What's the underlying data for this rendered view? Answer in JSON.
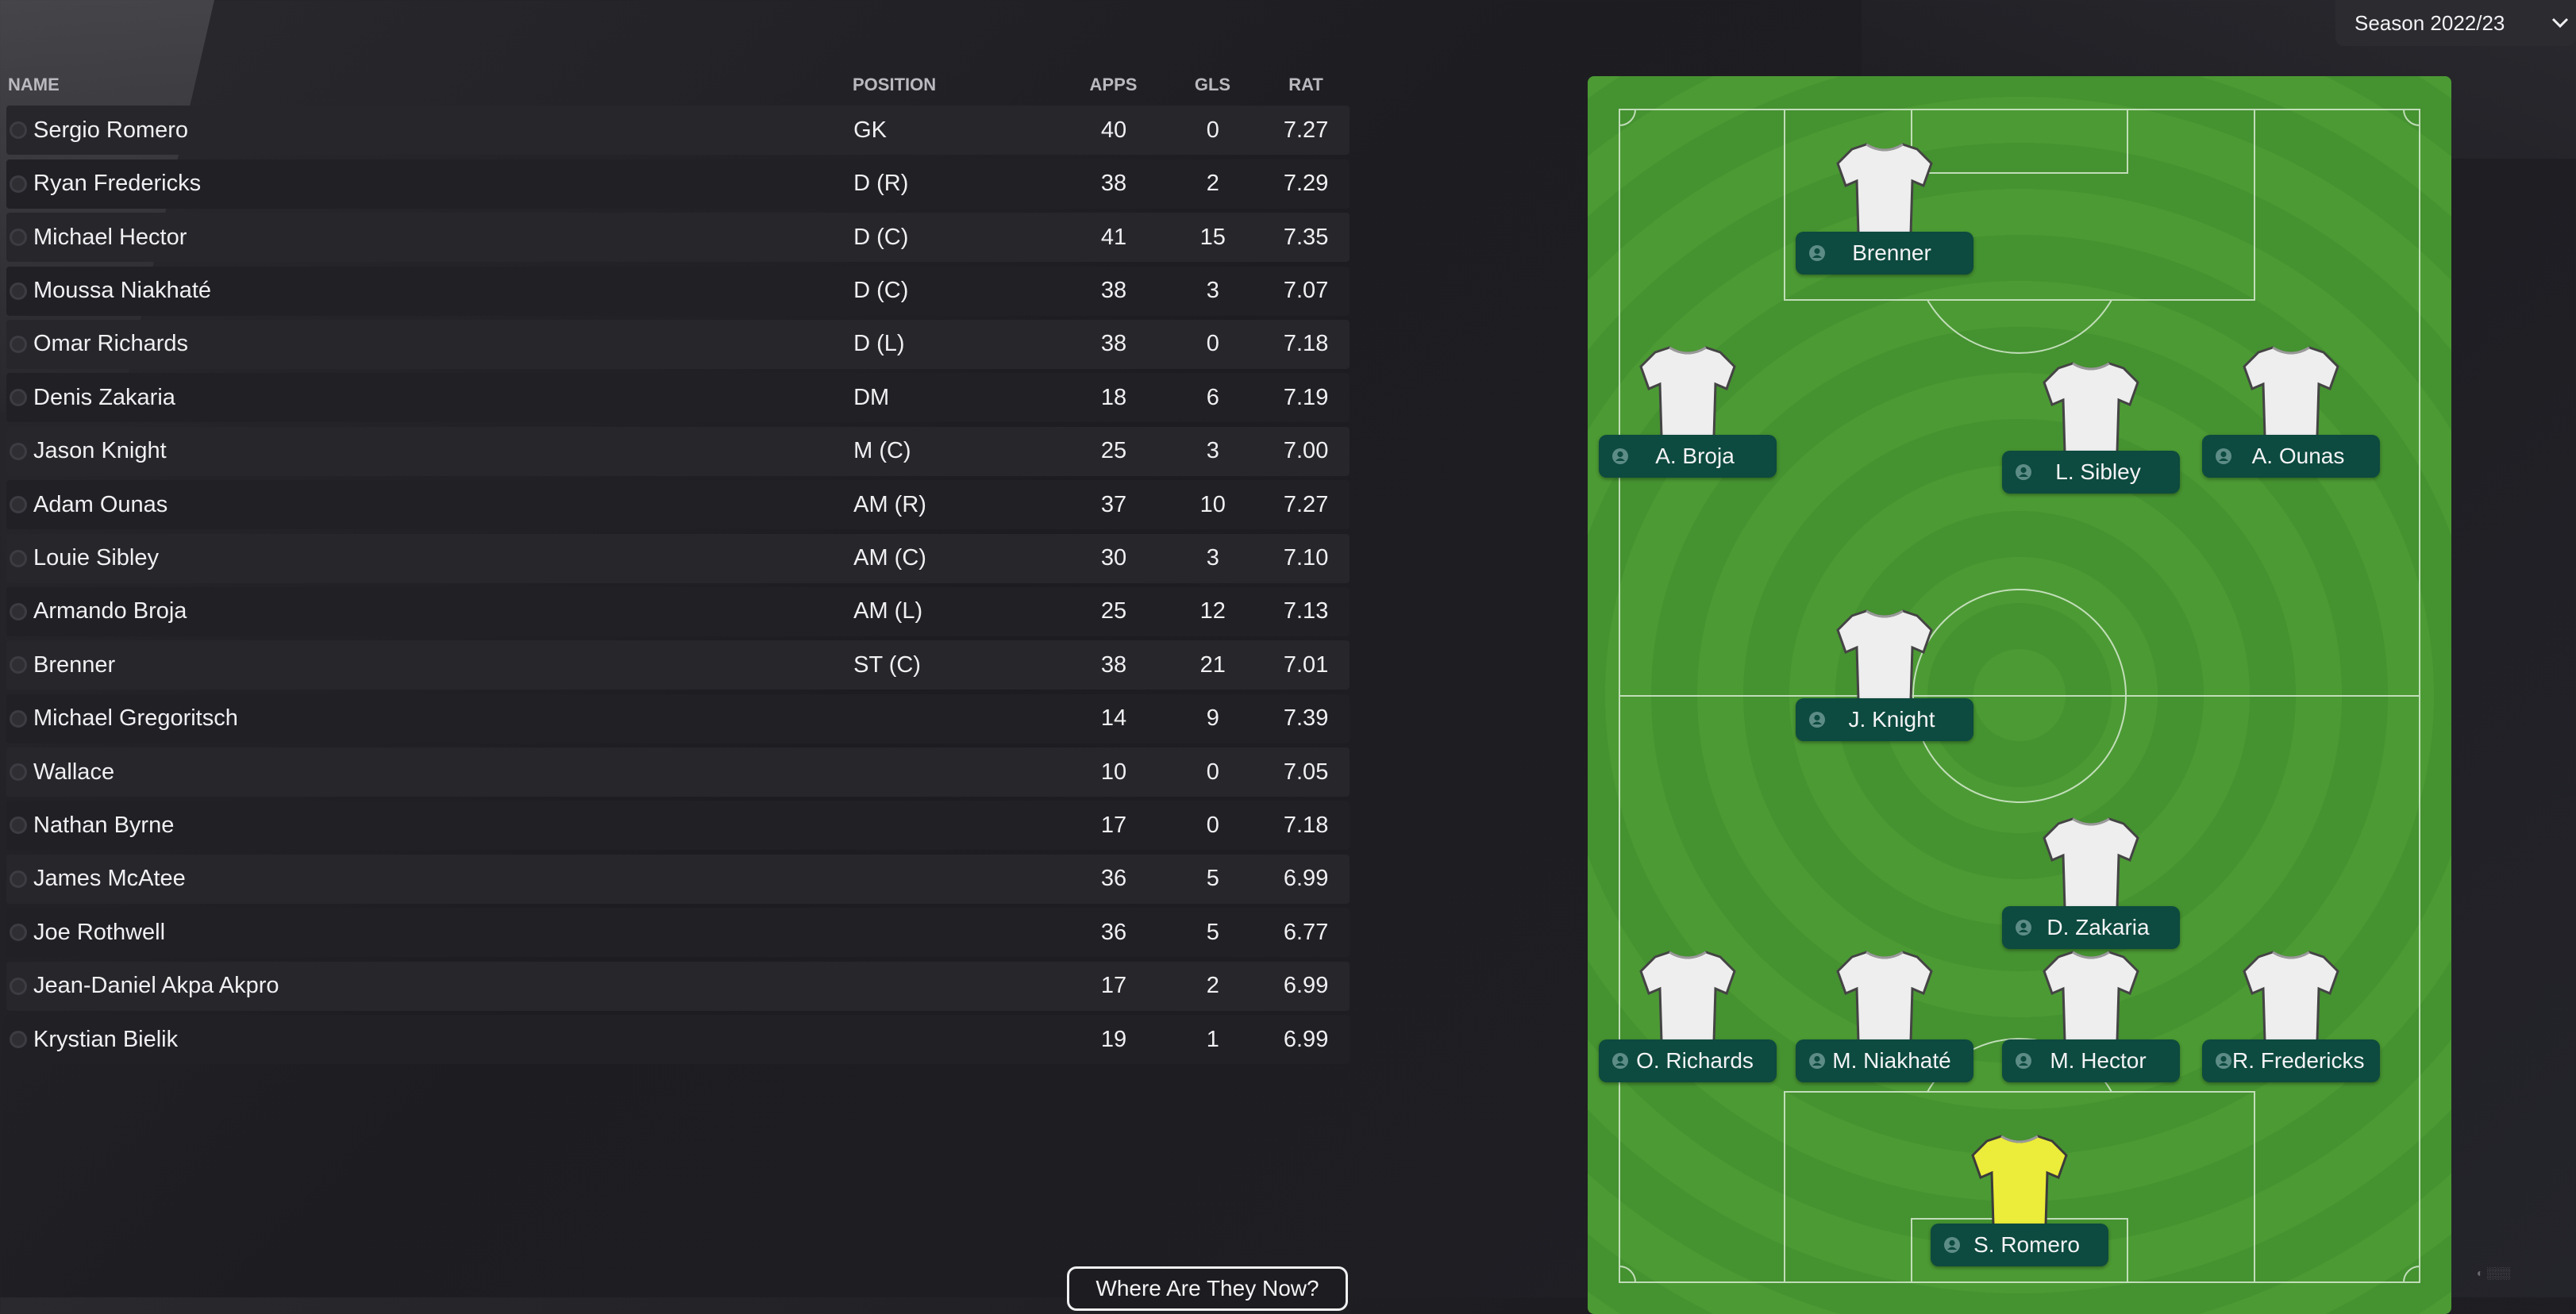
{
  "season": {
    "label": "Season 2022/23"
  },
  "table": {
    "headers": {
      "name": "NAME",
      "position": "POSITION",
      "apps": "APPS",
      "gls": "GLS",
      "rat": "RAT"
    },
    "rows": [
      {
        "name": "Sergio Romero",
        "position": "GK",
        "apps": "40",
        "gls": "0",
        "rat": "7.27"
      },
      {
        "name": "Ryan Fredericks",
        "position": "D (R)",
        "apps": "38",
        "gls": "2",
        "rat": "7.29"
      },
      {
        "name": "Michael Hector",
        "position": "D (C)",
        "apps": "41",
        "gls": "15",
        "rat": "7.35"
      },
      {
        "name": "Moussa Niakhaté",
        "position": "D (C)",
        "apps": "38",
        "gls": "3",
        "rat": "7.07"
      },
      {
        "name": "Omar Richards",
        "position": "D (L)",
        "apps": "38",
        "gls": "0",
        "rat": "7.18"
      },
      {
        "name": "Denis Zakaria",
        "position": "DM",
        "apps": "18",
        "gls": "6",
        "rat": "7.19"
      },
      {
        "name": "Jason Knight",
        "position": "M (C)",
        "apps": "25",
        "gls": "3",
        "rat": "7.00"
      },
      {
        "name": "Adam Ounas",
        "position": "AM (R)",
        "apps": "37",
        "gls": "10",
        "rat": "7.27"
      },
      {
        "name": "Louie Sibley",
        "position": "AM (C)",
        "apps": "30",
        "gls": "3",
        "rat": "7.10"
      },
      {
        "name": "Armando Broja",
        "position": "AM (L)",
        "apps": "25",
        "gls": "12",
        "rat": "7.13"
      },
      {
        "name": "Brenner",
        "position": "ST (C)",
        "apps": "38",
        "gls": "21",
        "rat": "7.01"
      },
      {
        "name": "Michael Gregoritsch",
        "position": "",
        "apps": "14",
        "gls": "9",
        "rat": "7.39"
      },
      {
        "name": "Wallace",
        "position": "",
        "apps": "10",
        "gls": "0",
        "rat": "7.05"
      },
      {
        "name": "Nathan Byrne",
        "position": "",
        "apps": "17",
        "gls": "0",
        "rat": "7.18"
      },
      {
        "name": "James McAtee",
        "position": "",
        "apps": "36",
        "gls": "5",
        "rat": "6.99"
      },
      {
        "name": "Joe Rothwell",
        "position": "",
        "apps": "36",
        "gls": "5",
        "rat": "6.77"
      },
      {
        "name": "Jean-Daniel Akpa Akpro",
        "position": "",
        "apps": "17",
        "gls": "2",
        "rat": "6.99"
      },
      {
        "name": "Krystian Bielik",
        "position": "",
        "apps": "19",
        "gls": "1",
        "rat": "6.99"
      }
    ]
  },
  "where_button": {
    "label": "Where Are They Now?"
  },
  "pitch": {
    "players": [
      {
        "id": "brenner",
        "name": "Brenner",
        "kit": "outfield"
      },
      {
        "id": "broja",
        "name": "A. Broja",
        "kit": "outfield"
      },
      {
        "id": "sibley",
        "name": "L. Sibley",
        "kit": "outfield"
      },
      {
        "id": "ounas",
        "name": "A. Ounas",
        "kit": "outfield"
      },
      {
        "id": "knight",
        "name": "J. Knight",
        "kit": "outfield"
      },
      {
        "id": "zakaria",
        "name": "D. Zakaria",
        "kit": "outfield"
      },
      {
        "id": "richards",
        "name": "O. Richards",
        "kit": "outfield"
      },
      {
        "id": "niakhate",
        "name": "M. Niakhaté",
        "kit": "outfield"
      },
      {
        "id": "hector",
        "name": "M. Hector",
        "kit": "outfield"
      },
      {
        "id": "fredericks",
        "name": "R. Fredericks",
        "kit": "outfield"
      },
      {
        "id": "romero",
        "name": "S. Romero",
        "kit": "goalkeeper"
      }
    ]
  },
  "colors": {
    "pitch_light": "#4c9a34",
    "pitch_dark": "#459230",
    "name_box": "#0d4a3f",
    "gk_shirt": "#ecec3a",
    "outfield_shirt": "#eeeeee"
  }
}
